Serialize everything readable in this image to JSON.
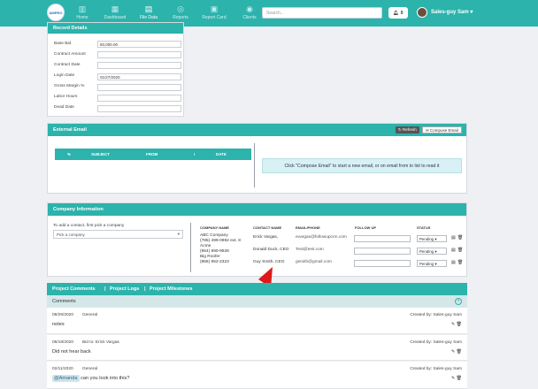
{
  "logo": {
    "text": "AMPRO"
  },
  "nav": [
    {
      "label": "Home",
      "icon": "bar-chart-icon"
    },
    {
      "label": "Dashboard",
      "icon": "dashboard-icon"
    },
    {
      "label": "File Data",
      "icon": "folder-icon"
    },
    {
      "label": "Reports",
      "icon": "reports-icon"
    },
    {
      "label": "Report Card",
      "icon": "report-card-icon"
    },
    {
      "label": "Clients",
      "icon": "clients-icon"
    }
  ],
  "search": {
    "placeholder": "Search..."
  },
  "notifications": {
    "count": "0"
  },
  "user": {
    "name": "Sales-guy Sam"
  },
  "record_details": {
    "title": "Record Details",
    "fields": [
      {
        "label": "Base Bid",
        "value": "50,000.00"
      },
      {
        "label": "Contract Amount",
        "value": ""
      },
      {
        "label": "Contract Date",
        "value": ""
      },
      {
        "label": "Login Date",
        "value": "01/27/2020"
      },
      {
        "label": "Gross Margin %",
        "value": ""
      },
      {
        "label": "Labor Hours",
        "value": ""
      },
      {
        "label": "Dead Date",
        "value": ""
      }
    ]
  },
  "external_email": {
    "title": "External Email",
    "refresh_label": "Refresh",
    "compose_label": "Compose Email",
    "columns": [
      "%",
      "SUBJECT",
      "FROM",
      "!",
      "DATE"
    ],
    "note": "Click \"Compose Email\" to start a new email, or on email from to list to read it"
  },
  "company_info": {
    "title": "Company Information",
    "hint": "To add a contact, first pick a company",
    "select_placeholder": "Pick a company",
    "headers": {
      "company": "COMPANY NAME",
      "contact": "CONTACT NAME",
      "email": "EMAIL/PHONE",
      "followup": "FOLLOW UP",
      "status": "STATUS"
    },
    "companies": [
      "ABC Company",
      "(785) 499-0992 ext. 8",
      "Acme",
      "(954) 990-9928",
      "Big Roofer",
      "(866) 852-2323"
    ],
    "contacts": [
      {
        "name": "Erick Vargas,",
        "email": "evargas@followupcrm.com",
        "status": "Pending"
      },
      {
        "name": "Donald Duck, CEO",
        "email": "Test@test.com",
        "status": "Pending"
      },
      {
        "name": "Guy Smith, CEO",
        "email": "gsmith@gmail.com",
        "status": "Pending"
      }
    ]
  },
  "project_tabs": {
    "comments": "Project Comments",
    "logs": "Project Logs",
    "milestones": "Project Milestones",
    "sep": "|"
  },
  "comments": {
    "title": "Comments",
    "items": [
      {
        "date": "08/26/2020",
        "type": "General",
        "by": "Created by: Sales-guy Sam",
        "text": "notes"
      },
      {
        "date": "05/18/2020",
        "type": "Bid to: Erick Vargas",
        "by": "Created by: Sales-guy Sam",
        "text": "Did not hear back"
      },
      {
        "date": "02/11/2020",
        "type": "General",
        "by": "Created by: Sales-guy Sam",
        "mention": "@Amanda",
        "text": "can you look into this?"
      }
    ]
  },
  "colors": {
    "accent": "#2bb3ac",
    "arrow": "#e01818"
  }
}
